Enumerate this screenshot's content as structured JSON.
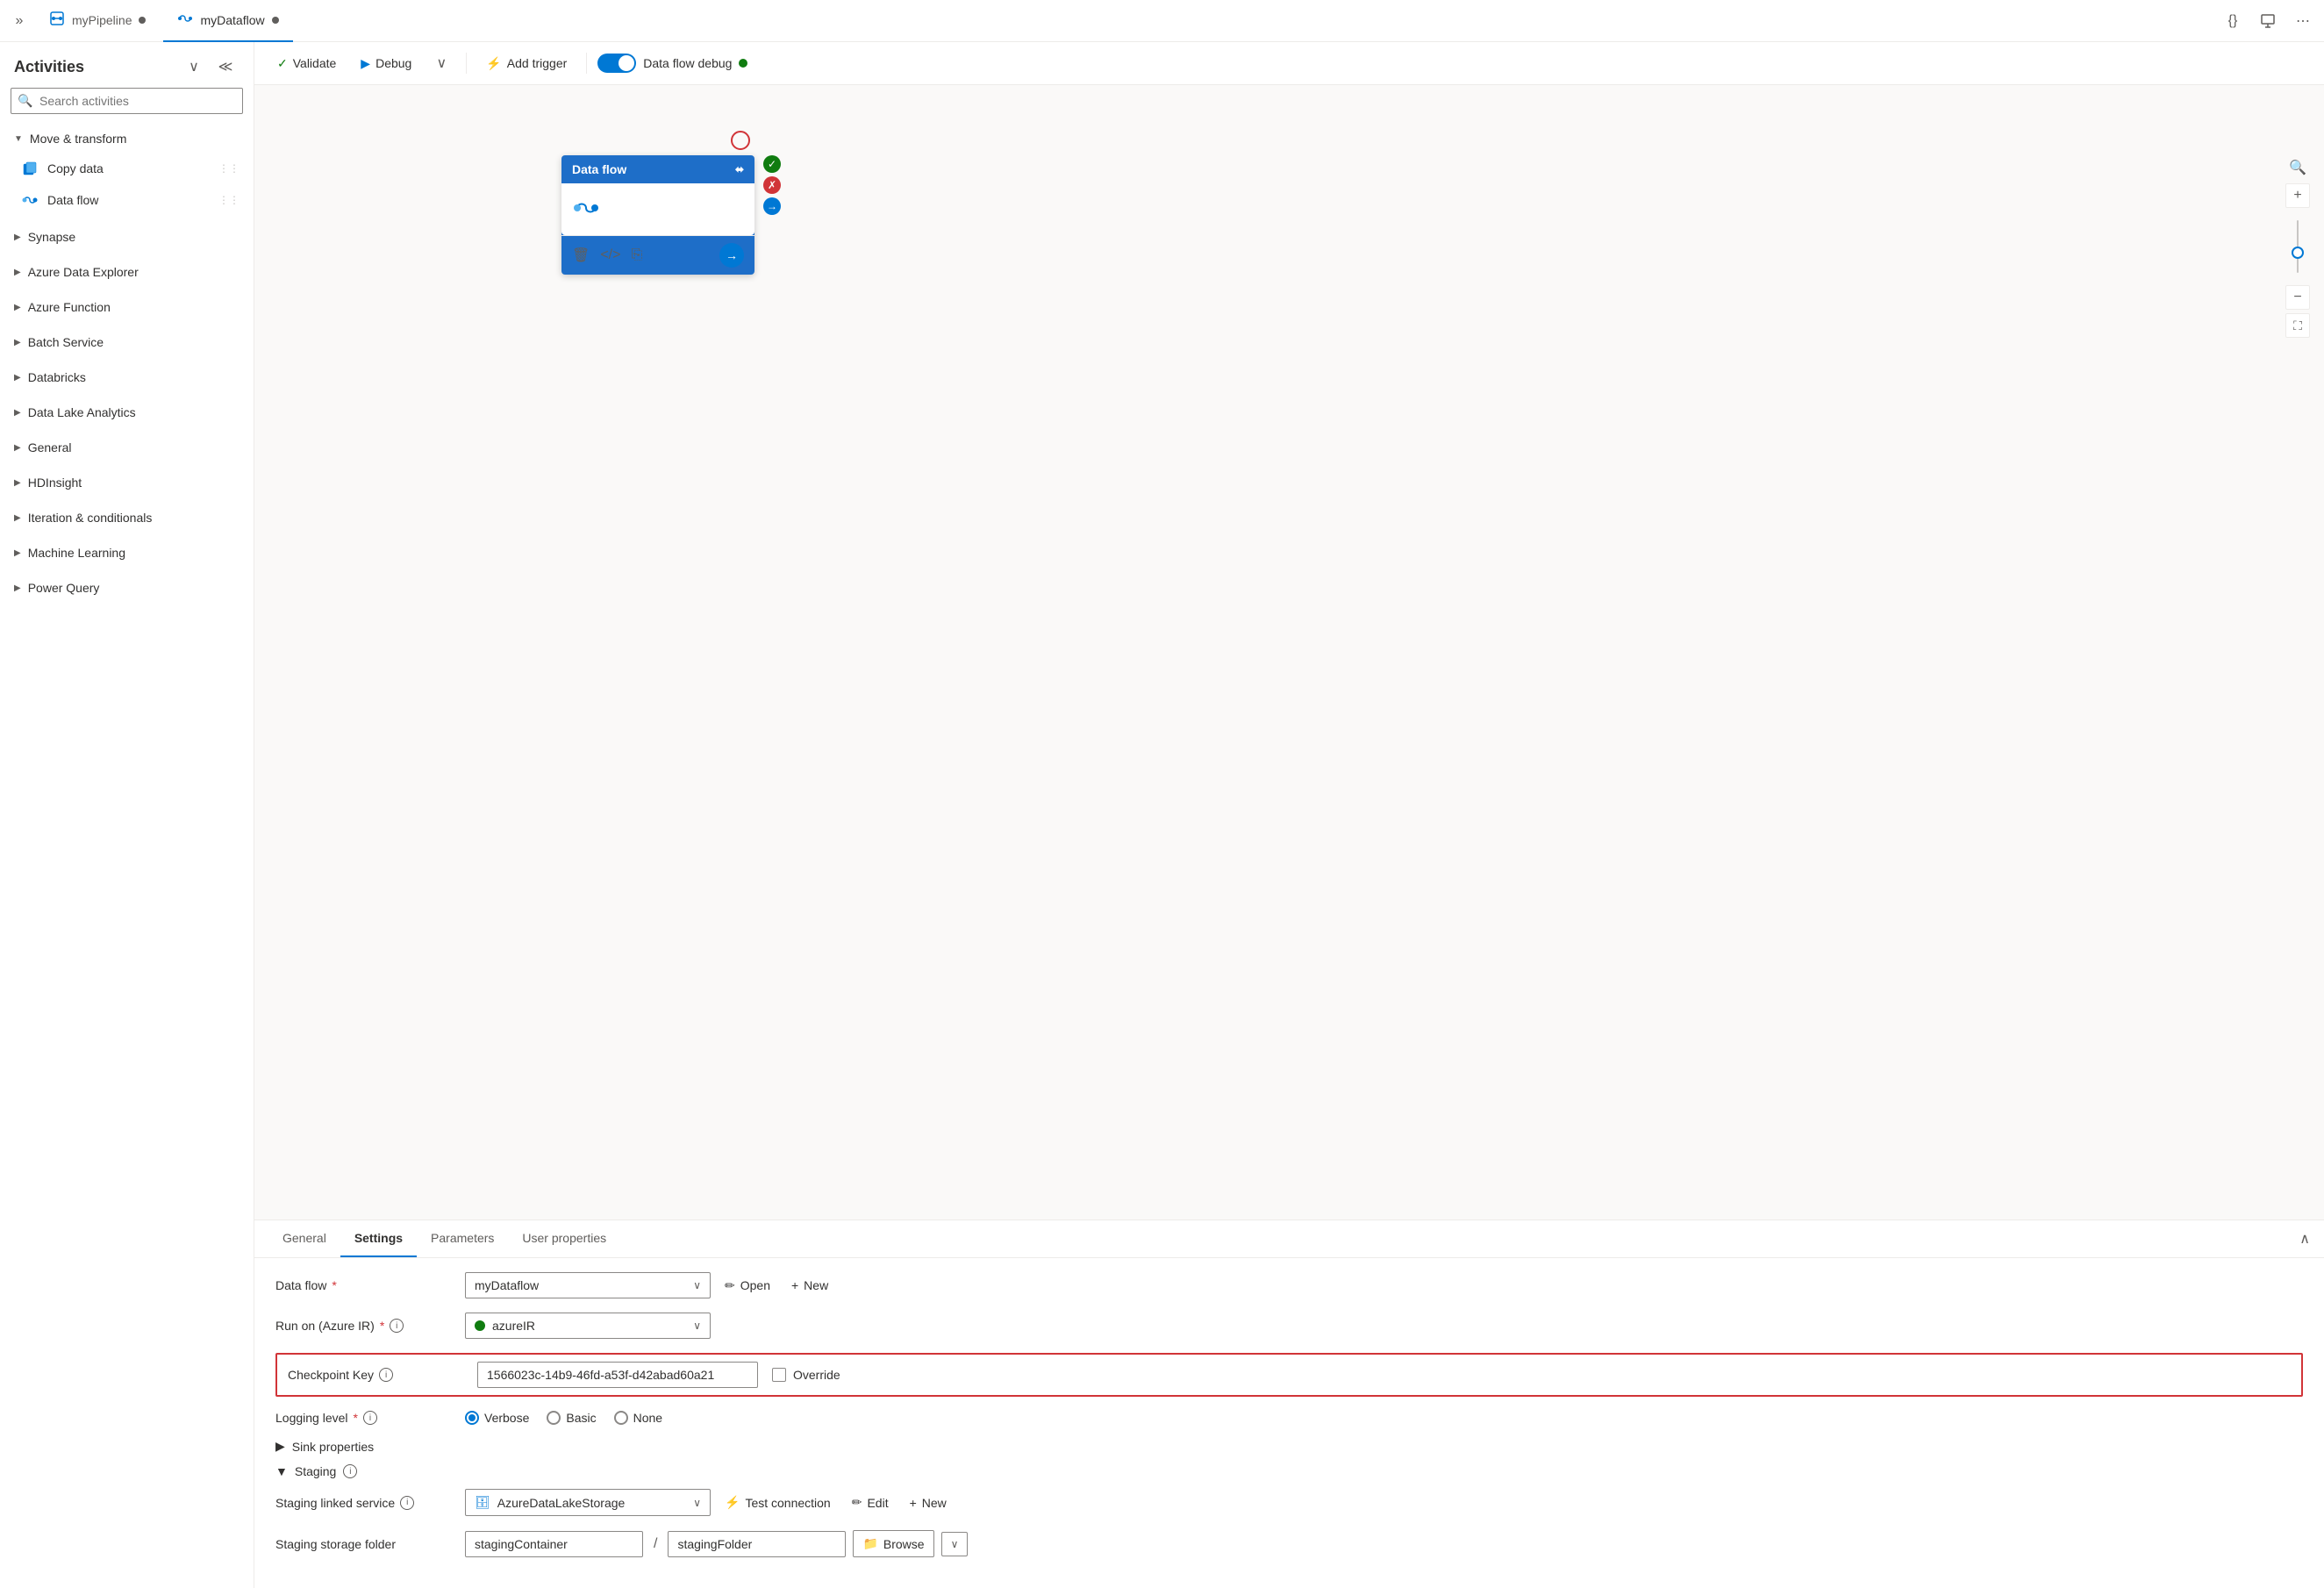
{
  "tabs": [
    {
      "id": "pipeline",
      "label": "myPipeline",
      "icon": "pipeline",
      "active": false,
      "modified": true
    },
    {
      "id": "dataflow",
      "label": "myDataflow",
      "icon": "dataflow",
      "active": true,
      "modified": true
    }
  ],
  "toolbar": {
    "validate_label": "Validate",
    "debug_label": "Debug",
    "add_trigger_label": "Add trigger",
    "dataflow_debug_label": "Data flow debug",
    "debug_active": true
  },
  "sidebar": {
    "title": "Activities",
    "search_placeholder": "Search activities",
    "sections": [
      {
        "label": "Move & transform",
        "expanded": true,
        "items": [
          {
            "label": "Copy data",
            "icon": "copy"
          },
          {
            "label": "Data flow",
            "icon": "dataflow"
          }
        ]
      },
      {
        "label": "Synapse",
        "expanded": false,
        "items": []
      },
      {
        "label": "Azure Data Explorer",
        "expanded": false,
        "items": []
      },
      {
        "label": "Azure Function",
        "expanded": false,
        "items": []
      },
      {
        "label": "Batch Service",
        "expanded": false,
        "items": []
      },
      {
        "label": "Databricks",
        "expanded": false,
        "items": []
      },
      {
        "label": "Data Lake Analytics",
        "expanded": false,
        "items": []
      },
      {
        "label": "General",
        "expanded": false,
        "items": []
      },
      {
        "label": "HDInsight",
        "expanded": false,
        "items": []
      },
      {
        "label": "Iteration & conditionals",
        "expanded": false,
        "items": []
      },
      {
        "label": "Machine Learning",
        "expanded": false,
        "items": []
      },
      {
        "label": "Power Query",
        "expanded": false,
        "items": []
      }
    ]
  },
  "canvas": {
    "node": {
      "title": "Data flow",
      "body_label": "Data flow"
    }
  },
  "panel": {
    "tabs": [
      "General",
      "Settings",
      "Parameters",
      "User properties"
    ],
    "active_tab": "Settings",
    "settings": {
      "dataflow_label": "Data flow",
      "dataflow_required": true,
      "dataflow_value": "myDataflow",
      "run_on_label": "Run on (Azure IR)",
      "run_on_required": true,
      "run_on_value": "azureIR",
      "checkpoint_key_label": "Checkpoint Key",
      "checkpoint_key_value": "1566023c-14b9-46fd-a53f-d42abad60a21",
      "override_label": "Override",
      "logging_level_label": "Logging level",
      "logging_level_required": true,
      "logging_options": [
        "Verbose",
        "Basic",
        "None"
      ],
      "logging_selected": "Verbose",
      "sink_properties_label": "Sink properties",
      "staging_label": "Staging",
      "staging_linked_service_label": "Staging linked service",
      "staging_linked_service_value": "AzureDataLakeStorage",
      "staging_storage_folder_label": "Staging storage folder",
      "staging_container_value": "stagingContainer",
      "staging_folder_value": "stagingFolder",
      "open_label": "Open",
      "new_label": "New",
      "test_connection_label": "Test connection",
      "edit_label": "Edit",
      "browse_label": "Browse"
    }
  }
}
